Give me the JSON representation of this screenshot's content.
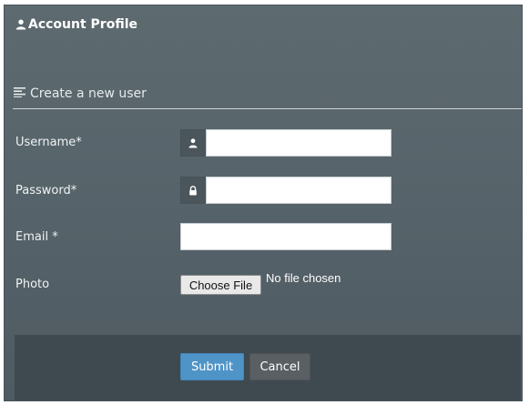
{
  "header": {
    "title": "Account Profile",
    "icon": "user-icon"
  },
  "form": {
    "legend": "Create a new user",
    "legend_icon": "list-icon",
    "username": {
      "label": "Username*",
      "value": "",
      "icon": "user-icon"
    },
    "password": {
      "label": "Password*",
      "value": "",
      "icon": "lock-icon"
    },
    "email": {
      "label": "Email *",
      "value": ""
    },
    "photo": {
      "label": "Photo",
      "button": "Choose File",
      "status": "No file chosen"
    }
  },
  "actions": {
    "submit": "Submit",
    "cancel": "Cancel"
  },
  "colors": {
    "panel": "#56636a",
    "footer": "#3f4a50",
    "submit": "#4f94c7",
    "cancel": "#595f62"
  }
}
